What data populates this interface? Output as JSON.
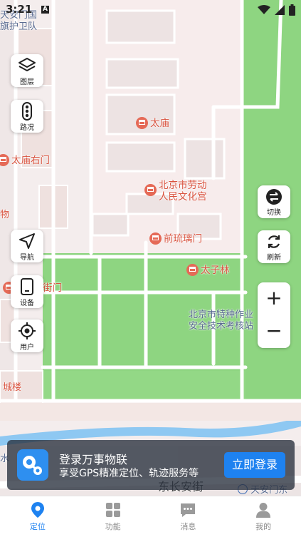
{
  "status_bar": {
    "time": "3:21",
    "badge": "A"
  },
  "map": {
    "pois": [
      {
        "name": "太庙"
      },
      {
        "name": "太庙右门"
      },
      {
        "name": "北京市劳动\n人民文化宫"
      },
      {
        "name": "前琉璃门"
      },
      {
        "name": "太子林"
      },
      {
        "name": "街门"
      }
    ],
    "labels": {
      "top_left": "天安门国\n旗护卫队",
      "inspection": "北京市特种作业\n安全技术考核站",
      "gate_tower": "城楼",
      "left_fragment": "物",
      "street": "东长安街",
      "metro_station": "天安门东",
      "bottom_left": "水"
    },
    "colors": {
      "forbidden_city": "#f7ecec",
      "park": "#8ed581",
      "water": "#8ec8f2",
      "road": "#ffffff"
    }
  },
  "left_controls": [
    {
      "label": "图层",
      "icon": "layers-icon"
    },
    {
      "label": "路况",
      "icon": "traffic-light-icon"
    },
    {
      "label": "导航",
      "icon": "navigation-icon"
    },
    {
      "label": "设备",
      "icon": "device-icon"
    },
    {
      "label": "用户",
      "icon": "locate-user-icon"
    }
  ],
  "right_controls": {
    "switch_label": "切换",
    "refresh_label": "刷新",
    "zoom_in": "+",
    "zoom_out": "−"
  },
  "banner": {
    "title": "登录万事物联",
    "subtitle": "享受GPS精准定位、轨迹服务等",
    "button": "立即登录"
  },
  "tabbar": {
    "active": 0,
    "tabs": [
      {
        "label": "定位",
        "icon": "location-pin-icon"
      },
      {
        "label": "功能",
        "icon": "grid-icon"
      },
      {
        "label": "消息",
        "icon": "message-icon"
      },
      {
        "label": "我的",
        "icon": "person-icon"
      }
    ]
  }
}
